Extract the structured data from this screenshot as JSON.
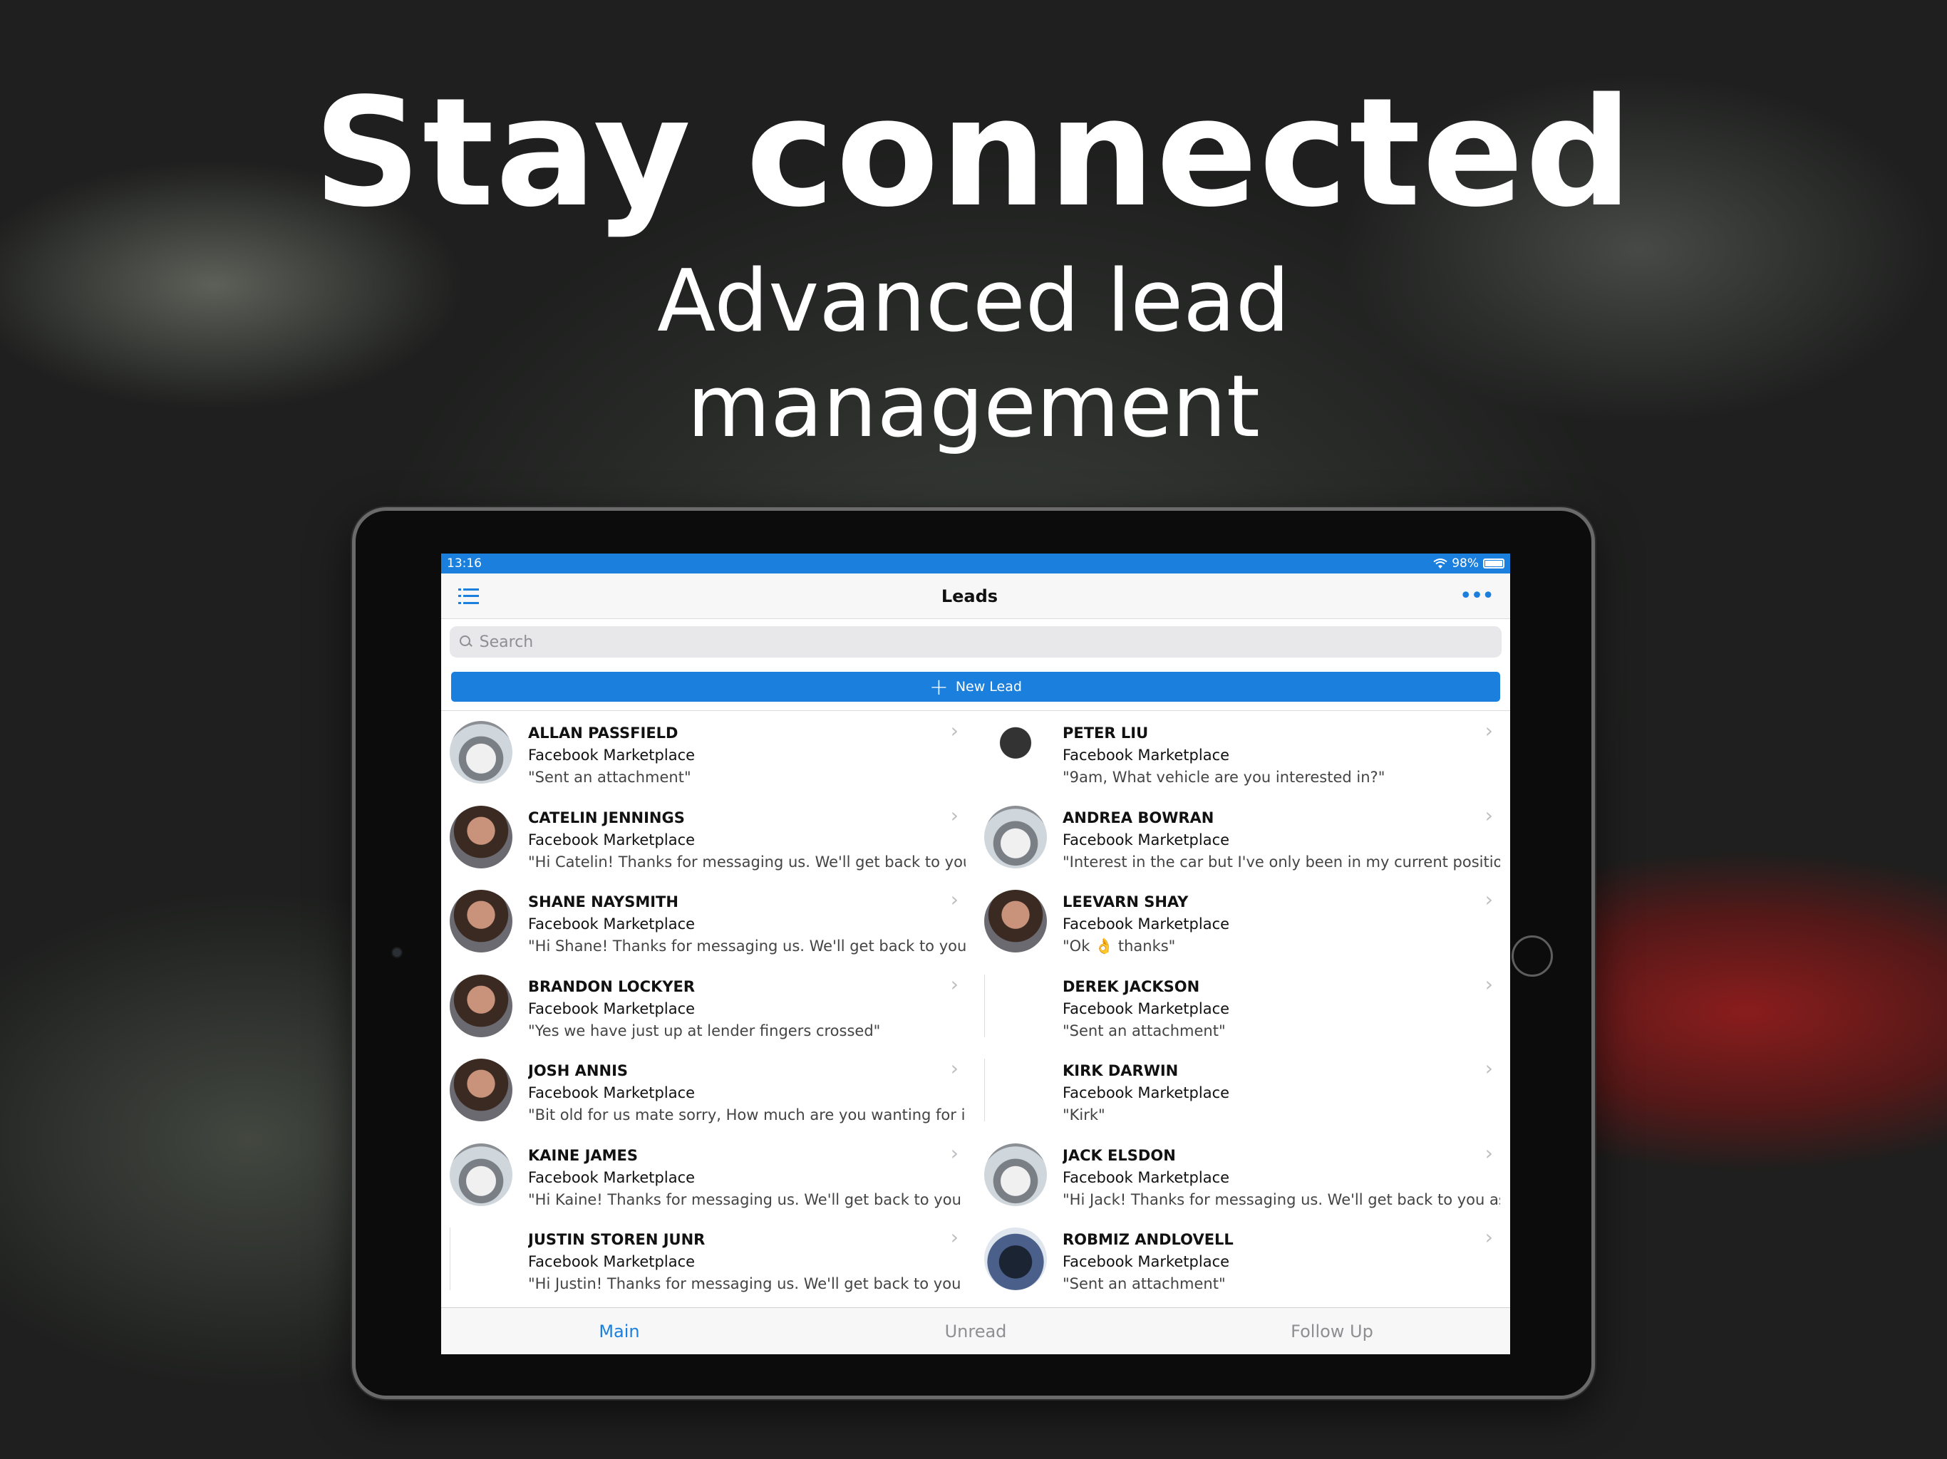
{
  "hero": {
    "title": "Stay connected",
    "subtitle": "Advanced lead management"
  },
  "status_bar": {
    "time": "13:16",
    "battery": "98%",
    "battery_level": 0.98
  },
  "nav": {
    "title": "Leads",
    "left_icon": "list-icon",
    "right_icon": "more-icon"
  },
  "search": {
    "placeholder": "Search"
  },
  "new_lead": {
    "label": "New Lead"
  },
  "colors": {
    "accent": "#1a7fdd",
    "tab_inactive": "#8e8e93"
  },
  "leads_left": [
    {
      "name": "ALLAN PASSFIELD",
      "source": "Facebook Marketplace",
      "message": "\"Sent an attachment\"",
      "avatar": "car-photo"
    },
    {
      "name": "CATELIN JENNINGS",
      "source": "Facebook Marketplace",
      "message": "\"Hi Catelin! Thanks for messaging us. We'll get back to you",
      "avatar": "person-photo"
    },
    {
      "name": "SHANE NAYSMITH",
      "source": "Facebook Marketplace",
      "message": "\"Hi Shane! Thanks for messaging us. We'll get back to you",
      "avatar": "person-photo"
    },
    {
      "name": "BRANDON LOCKYER",
      "source": "Facebook Marketplace",
      "message": "\"Yes we have just up at lender fingers crossed\"",
      "avatar": "person-photo"
    },
    {
      "name": "JOSH ANNIS",
      "source": "Facebook Marketplace",
      "message": "\"Bit old for us mate sorry, How much are you wanting for it\"",
      "avatar": "person-photo"
    },
    {
      "name": "KAINE JAMES",
      "source": "Facebook Marketplace",
      "message": "\"Hi Kaine! Thanks for messaging us. We'll get back to you",
      "avatar": "car-photo"
    },
    {
      "name": "JUSTIN STOREN JUNR",
      "source": "Facebook Marketplace",
      "message": "\"Hi Justin! Thanks for messaging us. We'll get back to you",
      "avatar": ""
    }
  ],
  "leads_right": [
    {
      "name": "PETER LIU",
      "source": "Facebook Marketplace",
      "message": "\"9am, What vehicle are you interested in?\"",
      "avatar": "meme-photo"
    },
    {
      "name": "ANDREA BOWRAN",
      "source": "Facebook Marketplace",
      "message": "\"Interest in the car but I've only been in my current position",
      "avatar": "car-photo"
    },
    {
      "name": "LEEVARN SHAY",
      "source": "Facebook Marketplace",
      "message": "\"Ok 👌 thanks\"",
      "avatar": "person-photo"
    },
    {
      "name": "DEREK JACKSON",
      "source": "Facebook Marketplace",
      "message": "\"Sent an attachment\"",
      "avatar": ""
    },
    {
      "name": "KIRK DARWIN",
      "source": "Facebook Marketplace",
      "message": "\"Kirk\"",
      "avatar": ""
    },
    {
      "name": "JACK ELSDON",
      "source": "Facebook Marketplace",
      "message": "\"Hi Jack! Thanks for messaging us. We'll get back to you as",
      "avatar": "car-photo"
    },
    {
      "name": "ROBMIZ ANDLOVELL",
      "source": "Facebook Marketplace",
      "message": "\"Sent an attachment\"",
      "avatar": "motorbike-photo"
    }
  ],
  "tabs": [
    {
      "label": "Main",
      "active": true
    },
    {
      "label": "Unread",
      "active": false
    },
    {
      "label": "Follow Up",
      "active": false
    }
  ]
}
